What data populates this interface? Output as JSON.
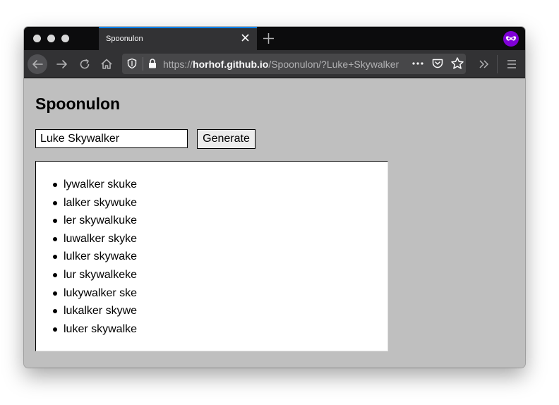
{
  "browser": {
    "tab_title": "Spoonulon",
    "url": {
      "scheme": "https://",
      "host": "horhof.github.io",
      "path": "/Spoonulon/?Luke+Skywalker"
    }
  },
  "page": {
    "title": "Spoonulon",
    "input_value": "Luke Skywalker",
    "generate_label": "Generate",
    "results": [
      "lywalker skuke",
      "lalker skywuke",
      "ler skywalkuke",
      "luwalker skyke",
      "lulker skywake",
      "lur skywalkeke",
      "lukywalker ske",
      "lukalker skywe",
      "luker skywalke"
    ]
  },
  "colors": {
    "page_background": "#bfbfbf",
    "tab_accent": "#0a84ff",
    "private_browsing": "#8000d7"
  }
}
